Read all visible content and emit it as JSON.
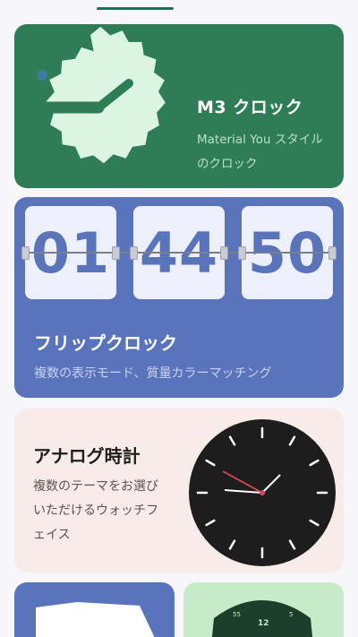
{
  "cards": {
    "m3": {
      "title": "M3 クロック",
      "desc": "Material You スタイルのクロック"
    },
    "flip": {
      "title": "フリップクロック",
      "desc": "複数の表示モード、質量カラーマッチング",
      "hours": "01",
      "minutes": "44",
      "seconds": "50"
    },
    "analog": {
      "title": "アナログ時計",
      "desc": "複数のテーマをお選びいただけるウォッチフェイス"
    },
    "partial_right": {
      "preview_numbers": [
        "55",
        "12",
        "5"
      ]
    }
  },
  "colors": {
    "m3_bg": "#2e7d57",
    "flip_bg": "#5a74bb",
    "analog_bg": "#f8ece8",
    "accent_tab": "#1f6f5a"
  }
}
